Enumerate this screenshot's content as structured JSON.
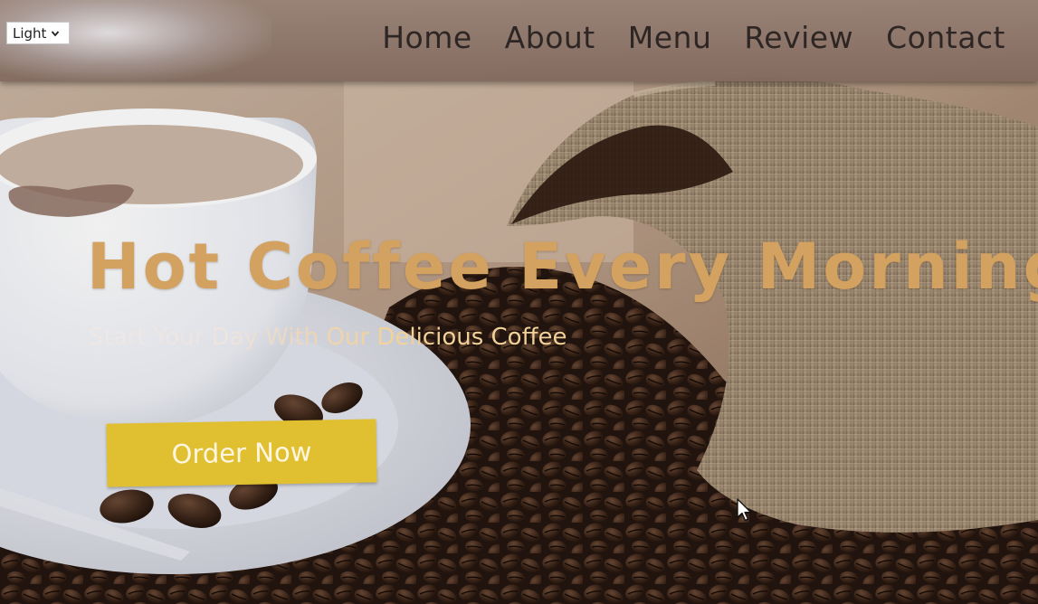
{
  "theme_select": {
    "value": "Light"
  },
  "nav": {
    "items": [
      "Home",
      "About",
      "Menu",
      "Review",
      "Contact"
    ]
  },
  "hero": {
    "title": "Hot Coffee Every Morning",
    "subtitle": "Start Your Day With Our Delicious Coffee",
    "cta_label": "Order Now"
  },
  "colors": {
    "header_bg": "#96807a",
    "nav_text": "#2e2624",
    "title_text": "#d3a160",
    "subtitle_text": "#f3d29a",
    "button_bg": "#e0c030",
    "button_text": "#fff6e2"
  },
  "icons": {
    "select_chevron": "chevron-down-icon",
    "pointer": "mouse-pointer-icon"
  }
}
